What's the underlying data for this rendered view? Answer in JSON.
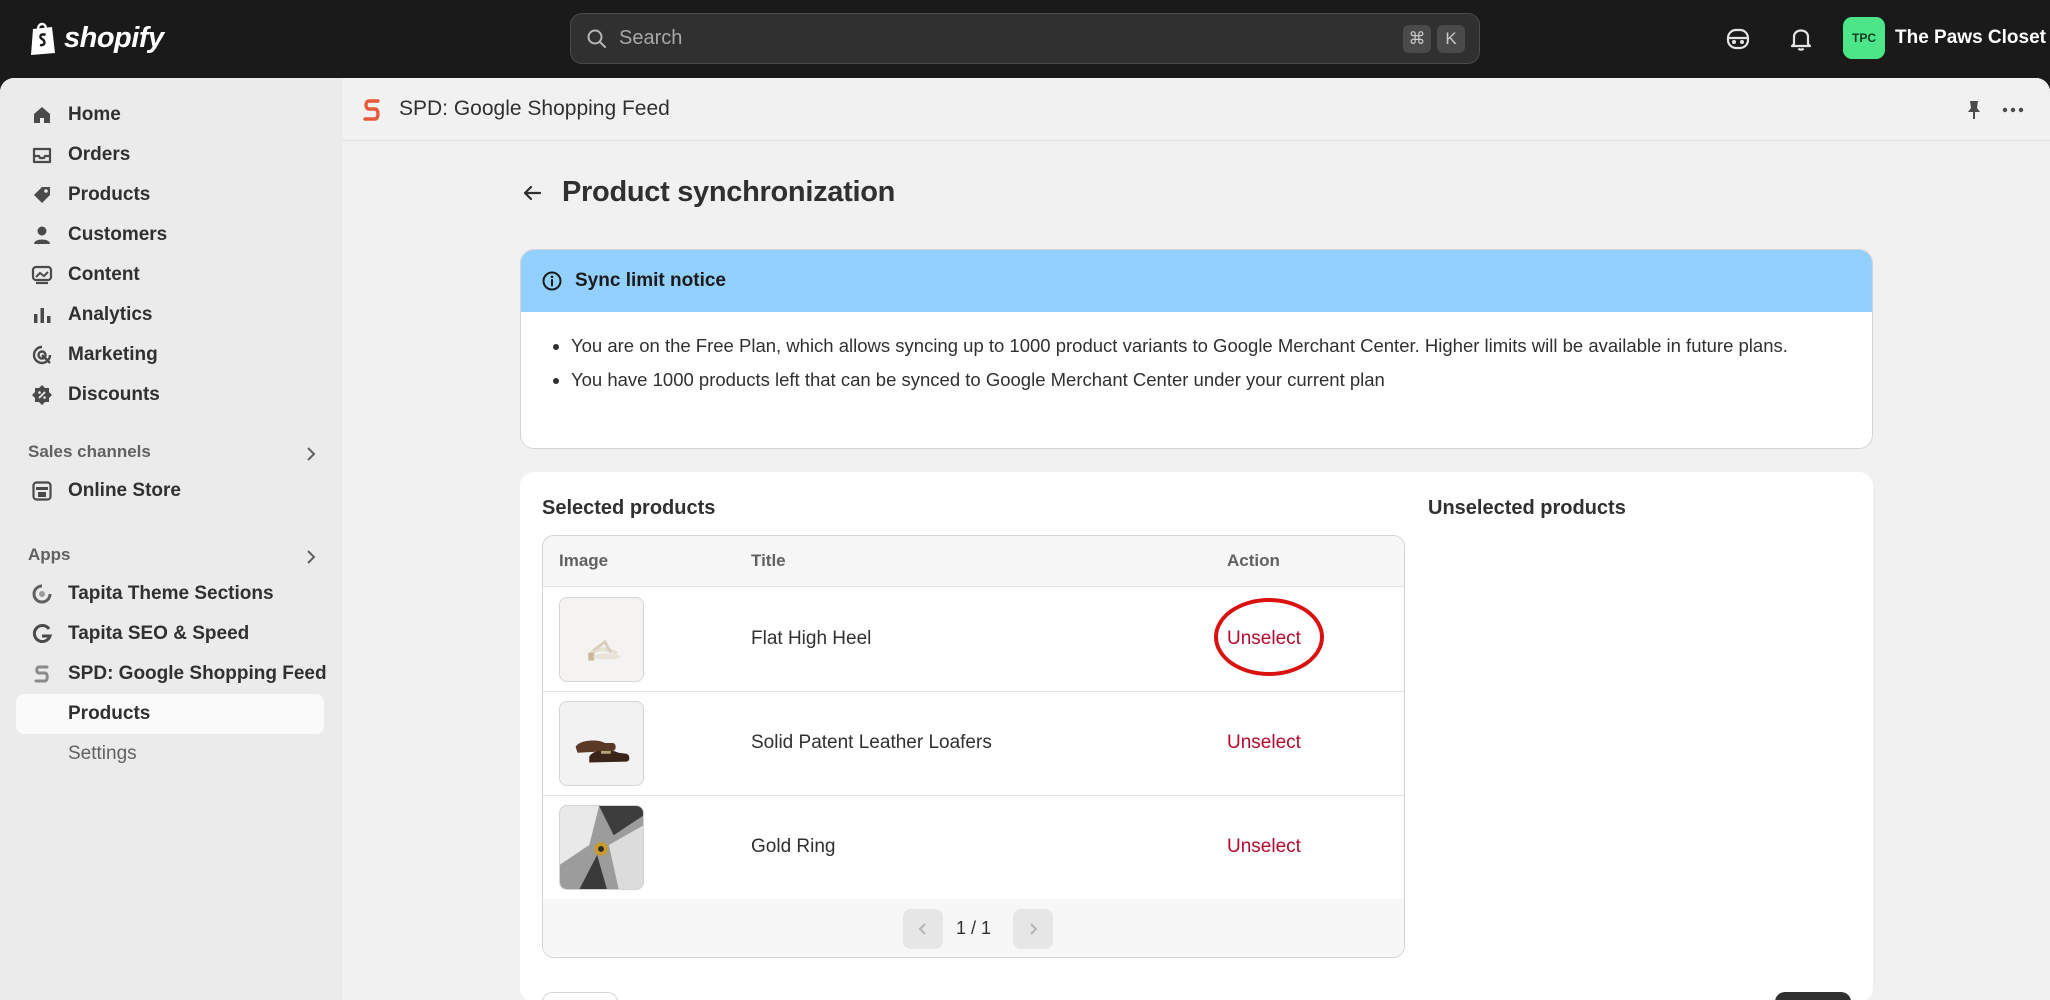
{
  "topbar": {
    "brand": "shopify",
    "search_placeholder": "Search",
    "shortcut_keys": [
      "⌘",
      "K"
    ],
    "store_initials": "TPC",
    "store_name": "The Paws Closet"
  },
  "sidebar": {
    "main_items": [
      {
        "label": "Home",
        "icon": "home-icon"
      },
      {
        "label": "Orders",
        "icon": "inbox-icon"
      },
      {
        "label": "Products",
        "icon": "tag-icon"
      },
      {
        "label": "Customers",
        "icon": "person-icon"
      },
      {
        "label": "Content",
        "icon": "image-icon"
      },
      {
        "label": "Analytics",
        "icon": "bar-chart-icon"
      },
      {
        "label": "Marketing",
        "icon": "target-icon"
      },
      {
        "label": "Discounts",
        "icon": "discount-icon"
      }
    ],
    "sales_channels_label": "Sales channels",
    "sales_channels": [
      {
        "label": "Online Store",
        "icon": "store-icon"
      }
    ],
    "apps_label": "Apps",
    "apps": [
      {
        "label": "Tapita Theme Sections",
        "icon": "tapita-sections-icon"
      },
      {
        "label": "Tapita SEO & Speed",
        "icon": "tapita-seo-icon"
      },
      {
        "label": "SPD: Google Shopping Feed",
        "icon": "spd-icon"
      }
    ],
    "app_sub_items": [
      "Products",
      "Settings"
    ]
  },
  "appbar": {
    "title": "SPD: Google Shopping Feed"
  },
  "page": {
    "title": "Product synchronization"
  },
  "banner": {
    "title": "Sync limit notice",
    "items": [
      "You are on the Free Plan, which allows syncing up to 1000 product variants to Google Merchant Center. Higher limits will be available in future plans.",
      "You have 1000 products left that can be synced to Google Merchant Center under your current plan"
    ]
  },
  "selected": {
    "title": "Selected products",
    "columns": [
      "Image",
      "Title",
      "Action"
    ],
    "rows": [
      {
        "title": "Flat High Heel",
        "action": "Unselect",
        "image": "sandal"
      },
      {
        "title": "Solid Patent Leather Loafers",
        "action": "Unselect",
        "image": "loafer"
      },
      {
        "title": "Gold Ring",
        "action": "Unselect",
        "image": "ring"
      }
    ],
    "pagination": "1 / 1"
  },
  "unselected": {
    "title": "Unselected products"
  },
  "colors": {
    "accent_red": "#b3092b",
    "banner_blue": "#91d0ff",
    "avatar_green": "#4ce688",
    "highlight_red": "#d9120f"
  }
}
